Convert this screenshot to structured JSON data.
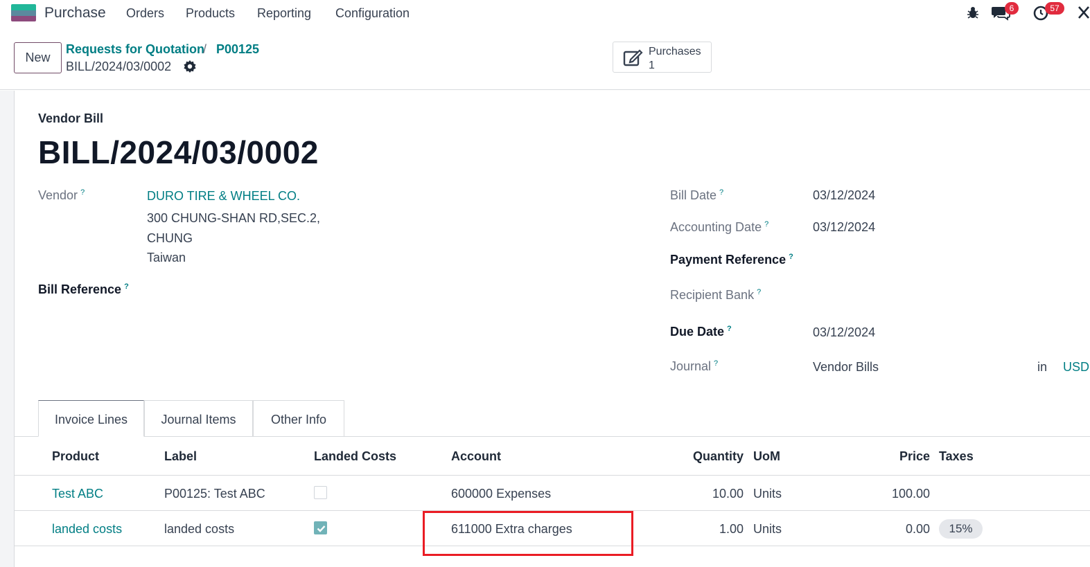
{
  "navbar": {
    "app_name": "Purchase",
    "menu": [
      "Orders",
      "Products",
      "Reporting",
      "Configuration"
    ],
    "messages_count": "6",
    "activities_count": "57"
  },
  "control_panel": {
    "new_label": "New",
    "breadcrumb": [
      "Requests for Quotation",
      "P00125"
    ],
    "breadcrumb_sep": "/",
    "current": "BILL/2024/03/0002",
    "smart_button": {
      "label": "Purchases",
      "value": "1"
    }
  },
  "form": {
    "doc_type": "Vendor Bill",
    "title": "BILL/2024/03/0002",
    "vendor_label": "Vendor",
    "vendor_name": "DURO TIRE & WHEEL CO.",
    "vendor_address": [
      "300 CHUNG-SHAN RD,SEC.2,",
      "CHUNG",
      "Taiwan"
    ],
    "bill_reference_label": "Bill Reference",
    "help_mark": "?",
    "bill_date_label": "Bill Date",
    "bill_date": "03/12/2024",
    "accounting_date_label": "Accounting Date",
    "accounting_date": "03/12/2024",
    "payment_reference_label": "Payment Reference",
    "recipient_bank_label": "Recipient Bank",
    "due_date_label": "Due Date",
    "due_date": "03/12/2024",
    "journal_label": "Journal",
    "journal": "Vendor Bills",
    "in_label": "in",
    "currency": "USD"
  },
  "tabs": [
    "Invoice Lines",
    "Journal Items",
    "Other Info"
  ],
  "lines": {
    "headers": [
      "Product",
      "Label",
      "Landed Costs",
      "Account",
      "Quantity",
      "UoM",
      "Price",
      "Taxes"
    ],
    "rows": [
      {
        "product": "Test ABC",
        "label": "P00125: Test ABC",
        "landed_costs": false,
        "account": "600000 Expenses",
        "quantity": "10.00",
        "uom": "Units",
        "price": "100.00",
        "taxes": ""
      },
      {
        "product": "landed costs",
        "label": "landed costs",
        "landed_costs": true,
        "account": "611000 Extra charges",
        "quantity": "1.00",
        "uom": "Units",
        "price": "0.00",
        "taxes": "15%"
      }
    ]
  },
  "colors": {
    "accent": "#017e84",
    "brand": "#714b67",
    "highlight": "#ea1c24",
    "badge": "#e12b3e"
  }
}
